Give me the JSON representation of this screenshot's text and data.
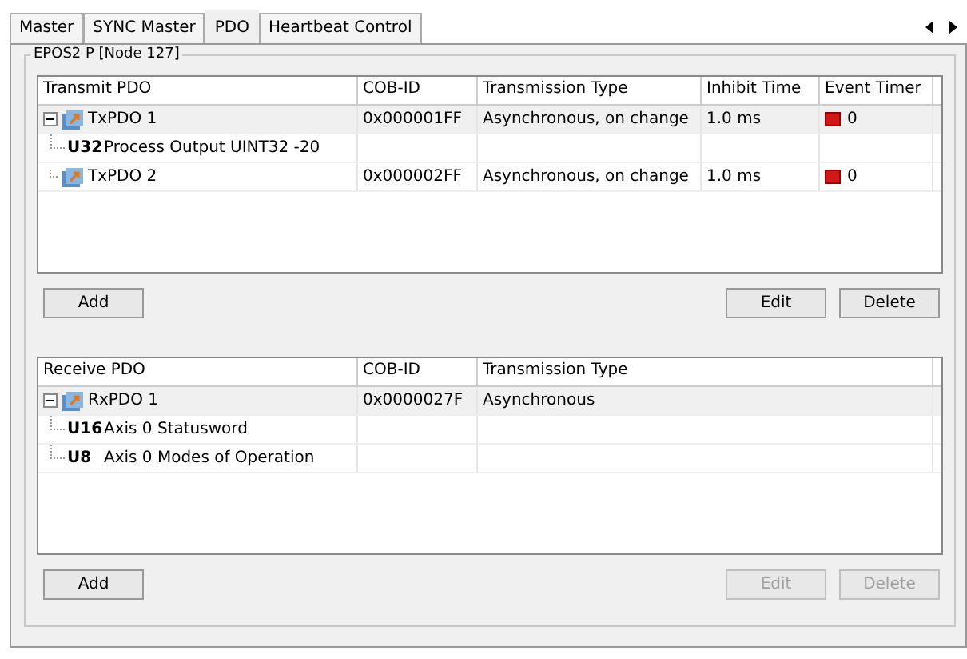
{
  "tabs": [
    {
      "label": "Master",
      "selected": false
    },
    {
      "label": "SYNC Master",
      "selected": false
    },
    {
      "label": "PDO",
      "selected": true
    },
    {
      "label": "Heartbeat Control",
      "selected": false
    }
  ],
  "group": {
    "title": "EPOS2 P [Node 127]"
  },
  "transmit": {
    "columns": [
      "Transmit PDO",
      "COB-ID",
      "Transmission Type",
      "Inhibit Time",
      "Event Timer"
    ],
    "rows": [
      {
        "expanded": true,
        "cells": [
          "TxPDO 1",
          "0x000001FF",
          "Asynchronous, on change",
          "1.0 ms",
          "0"
        ],
        "children": [
          {
            "type": "U32",
            "name": "Process Output UINT32 -20"
          }
        ]
      },
      {
        "expanded": false,
        "cells": [
          "TxPDO 2",
          "0x000002FF",
          "Asynchronous, on change",
          "1.0 ms",
          "0"
        ]
      }
    ],
    "buttons": [
      {
        "label": "Add",
        "disabled": false
      },
      {
        "label": "Edit",
        "disabled": false
      },
      {
        "label": "Delete",
        "disabled": false
      }
    ]
  },
  "receive": {
    "columns": [
      "Receive PDO",
      "COB-ID",
      "Transmission Type"
    ],
    "rows": [
      {
        "expanded": true,
        "cells": [
          "RxPDO 1",
          "0x0000027F",
          "Asynchronous"
        ],
        "children": [
          {
            "type": "U16",
            "name": "Axis 0 Statusword"
          },
          {
            "type": "U8",
            "name": "Axis 0 Modes of Operation"
          }
        ]
      }
    ],
    "buttons": [
      {
        "label": "Add",
        "disabled": false
      },
      {
        "label": "Edit",
        "disabled": true
      },
      {
        "label": "Delete",
        "disabled": true
      }
    ]
  }
}
